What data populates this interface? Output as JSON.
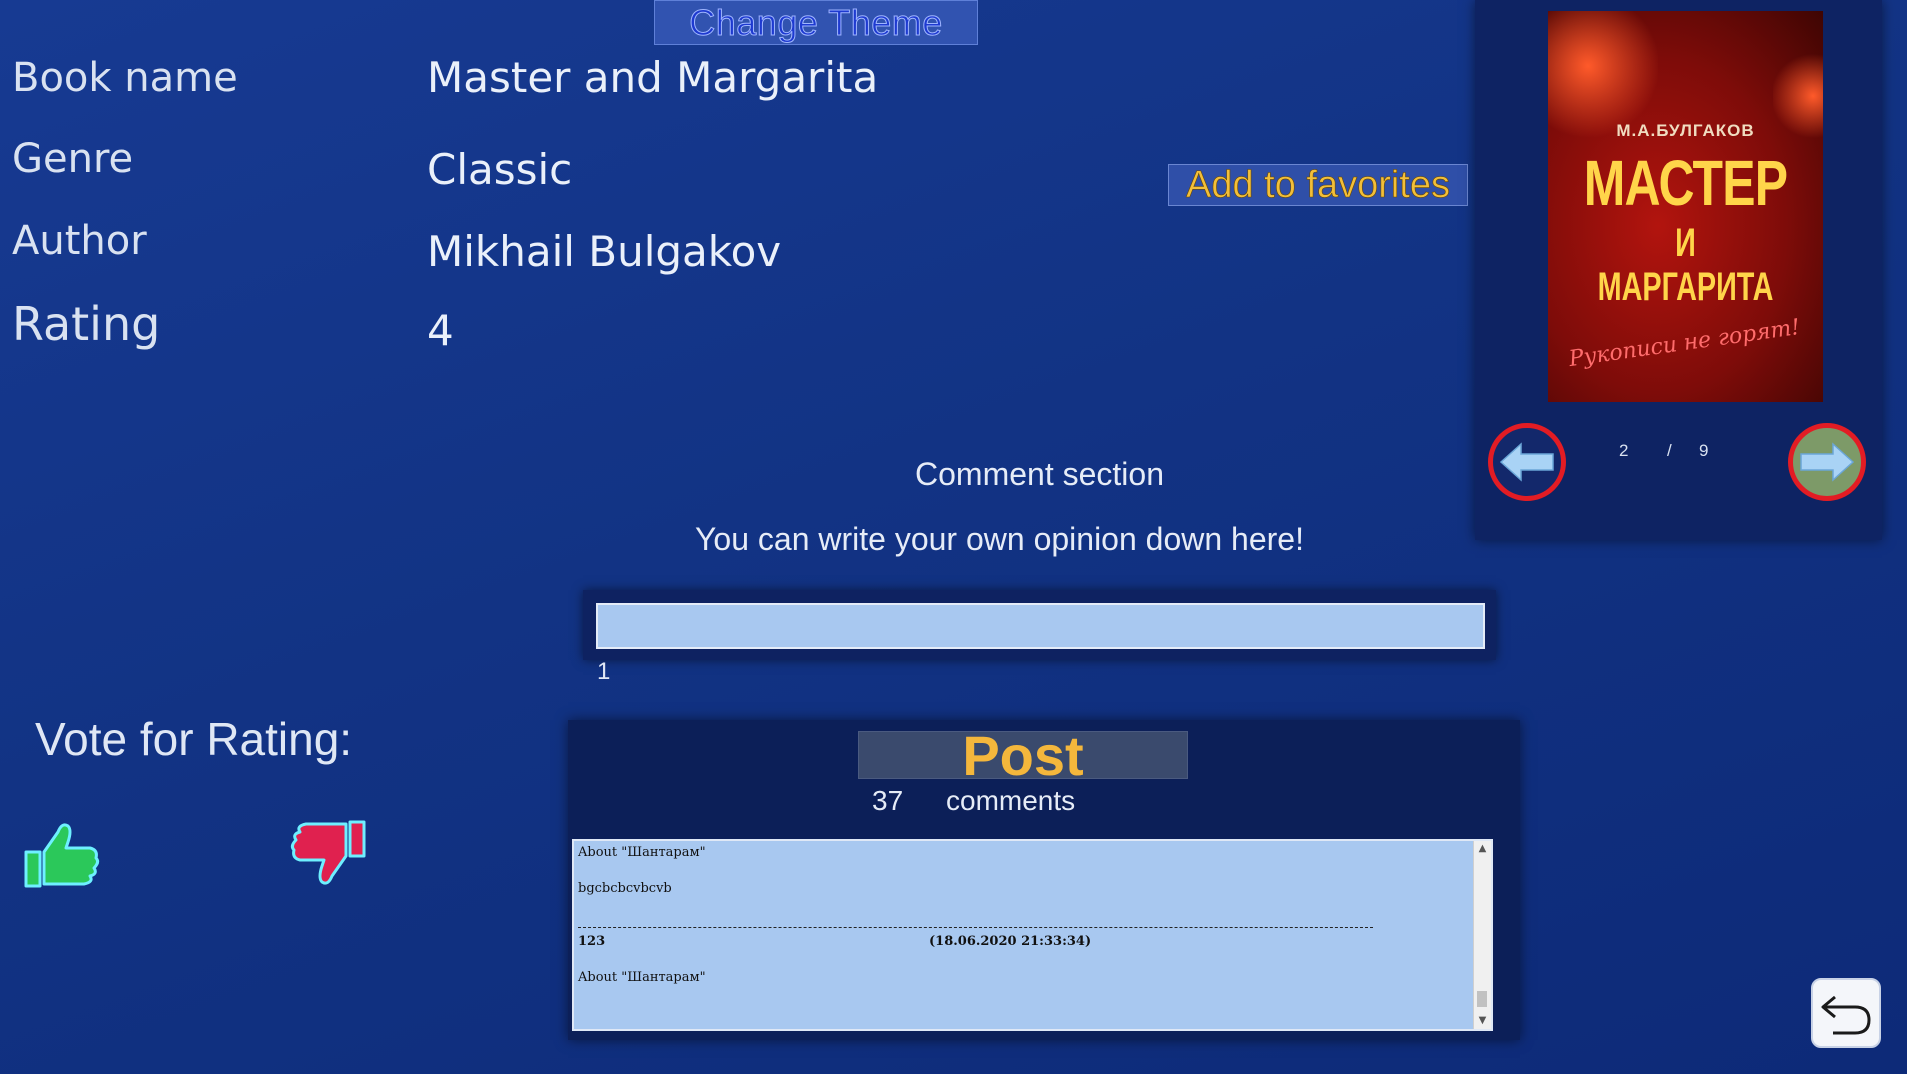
{
  "toolbar": {
    "change_theme_label": "Change Theme"
  },
  "book": {
    "labels": {
      "name": "Book name",
      "genre": "Genre",
      "author": "Author",
      "rating": "Rating"
    },
    "values": {
      "name": "Master and Margarita",
      "genre": "Classic",
      "author": "Mikhail Bulgakov",
      "rating": "4"
    },
    "add_favorites_label": "Add to favorites"
  },
  "gallery": {
    "cover": {
      "author": "М.А.БУЛГАКОВ",
      "title_line1": "МАСТЕР",
      "title_line2": "И МАРГАРИТА",
      "tagline": "Рукописи не горят!"
    },
    "current": "2",
    "separator": "/",
    "total": "9",
    "prev_icon": "arrow-left-icon",
    "next_icon": "arrow-right-icon"
  },
  "comments": {
    "title": "Comment section",
    "hint": "You can write your own opinion down here!",
    "input_value": "",
    "char_count": "1",
    "post_label": "Post",
    "count": "37",
    "count_label": "comments",
    "entries": [
      {
        "line1": "About \"Шантарам\"",
        "line2": "bgcbcbcvbcvb"
      },
      {
        "author": "123",
        "date": "(18.06.2020 21:33:34)",
        "line1": "About \"Шантарам\""
      }
    ]
  },
  "vote": {
    "title": "Vote for Rating:",
    "like_icon": "thumbs-up-icon",
    "dislike_icon": "thumbs-down-icon"
  },
  "nav": {
    "back_icon": "undo-icon"
  },
  "colors": {
    "accent_yellow": "#f4b73c",
    "nav_ring": "#e21c24",
    "input_bg": "#a8c8f0"
  }
}
